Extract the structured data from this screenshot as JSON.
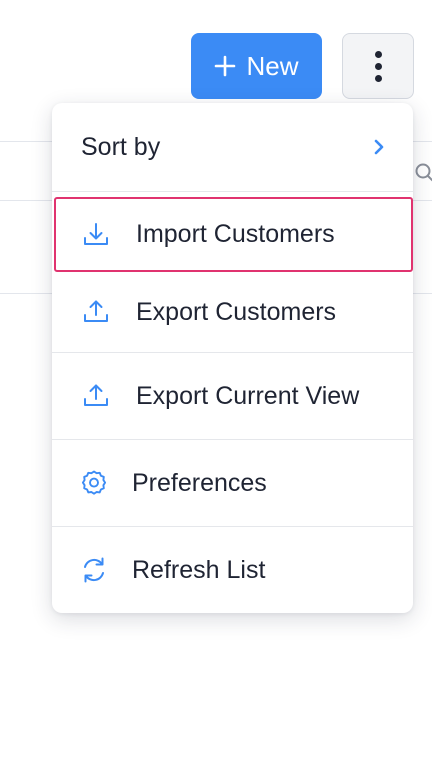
{
  "toolbar": {
    "new_label": "New",
    "new_icon": "plus-icon",
    "more_icon": "vertical-dots-icon",
    "accent_color": "#3b8bf5"
  },
  "menu": {
    "sort_by": {
      "label": "Sort by",
      "icon": "chevron-right-icon"
    },
    "items": [
      {
        "label": "Import Customers",
        "icon": "download-icon"
      },
      {
        "label": "Export Customers",
        "icon": "upload-icon"
      },
      {
        "label": "Export Current View",
        "icon": "upload-icon"
      },
      {
        "label": "Preferences",
        "icon": "gear-icon"
      },
      {
        "label": "Refresh List",
        "icon": "refresh-icon"
      }
    ],
    "highlight_color": "#e0336f",
    "icon_color": "#3b8bf5"
  },
  "background": {
    "search_icon": "search-icon"
  }
}
